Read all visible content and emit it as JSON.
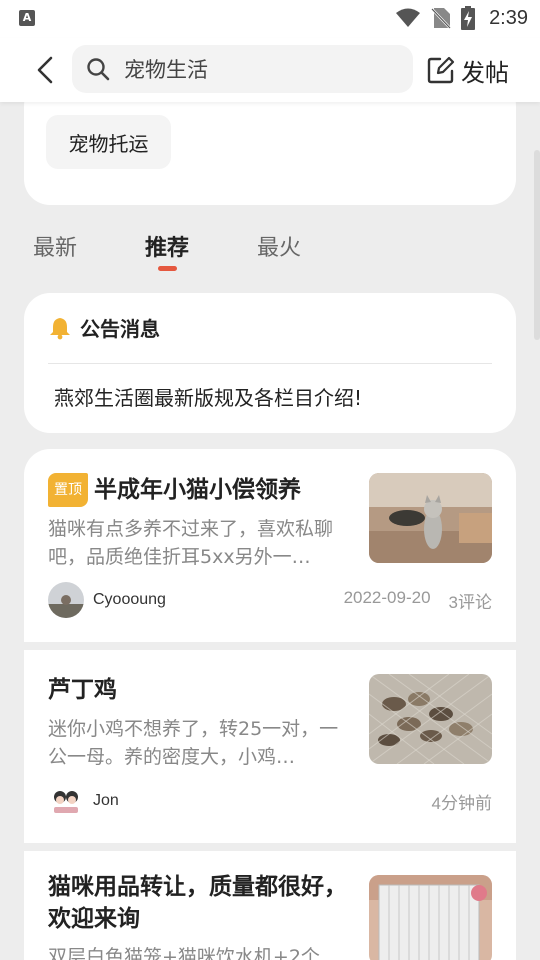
{
  "status_bar": {
    "app_icon": "A",
    "time": "2:39",
    "icons": [
      "wifi-icon",
      "no-sim-icon",
      "battery-charging-icon"
    ]
  },
  "header": {
    "search_text": "宠物生活",
    "post_label": "发帖"
  },
  "categories": {
    "chip": "宠物托运"
  },
  "tabs": {
    "latest": "最新",
    "recommended": "推荐",
    "hottest": "最火",
    "active": "推荐"
  },
  "notice": {
    "title": "公告消息",
    "item": "燕郊生活圈最新版规及各栏目介绍!"
  },
  "posts": [
    {
      "pinned_badge": "置顶",
      "title": "半成年小猫小偿领养",
      "desc": "猫咪有点多养不过来了，喜欢私聊吧，品质绝佳折耳5xx另外一…",
      "user": "Cyoooung",
      "date": "2022-09-20",
      "comments": "3评论",
      "thumb": "cat-photo"
    },
    {
      "title": "芦丁鸡",
      "desc": "迷你小鸡不想养了，转25一对，一公一母。养的密度大，小鸡…",
      "user": "Jon",
      "time": "4分钟前",
      "thumb": "quail-photo"
    },
    {
      "title": "猫咪用品转让，质量都很好，欢迎来询",
      "desc": "双层白色猫笼+猫咪饮水机+2个",
      "thumb": "cat-cage-photo"
    }
  ],
  "colors": {
    "accent": "#e5583f",
    "pin_badge": "#f2b233",
    "bell": "#f2b233",
    "background": "#ededed"
  }
}
